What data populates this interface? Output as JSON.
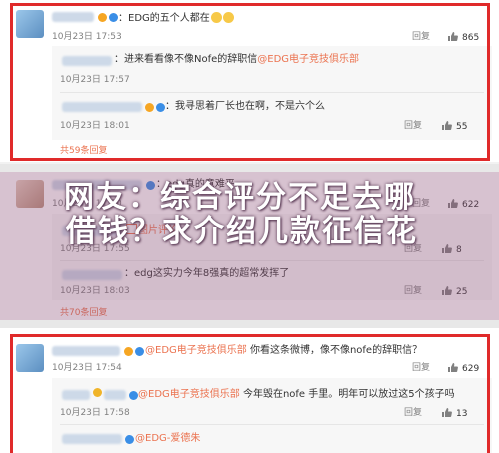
{
  "comments": [
    {
      "text_prefix": "：EDG的五个人都在",
      "time": "10月23日 17:53",
      "reply": "回复",
      "likes": "865",
      "replies": [
        {
          "text_prefix": "：进来看看像不像Nofe的辞职信",
          "mention": "@EDG电子竞技俱乐部",
          "time": "10月23日 17:57"
        },
        {
          "text_prefix": "：我寻思着厂长也在啊，不是六个么",
          "time": "10月23日 18:01",
          "reply": "回复",
          "likes": "55"
        }
      ],
      "more": "共59条回复"
    },
    {
      "text_prefix": "：edg真的意难平",
      "time": "10月23日 17:50",
      "reply": "回复",
      "likes": "622",
      "replies": [
        {
          "img_label": "图片评论",
          "time": "10月23日 17:55",
          "reply": "回复",
          "likes": "8"
        },
        {
          "text_prefix": "：edg这实力今年8强真的超常发挥了",
          "time": "10月23日 18:03",
          "reply": "回复",
          "likes": "25"
        }
      ],
      "more": "共70条回复"
    },
    {
      "mention": "@EDG电子竞技俱乐部",
      "text_suffix": " 你看这条微博，像不像nofe的辞职信？",
      "time": "10月23日 17:54",
      "reply": "回复",
      "likes": "629",
      "replies": [
        {
          "mention": "@EDG电子竞技俱乐部",
          "text_suffix": " 今年毁在nofe 手里。明年可以放过这5个孩子吗",
          "time": "10月23日 17:58",
          "reply": "回复",
          "likes": "13"
        },
        {
          "mention": "@EDG-爱德朱"
        }
      ]
    }
  ],
  "overlay": {
    "line1": "网友：综合评分不足去哪",
    "line2": "借钱？求介绍几款征信花"
  },
  "colors": {
    "accent": "#eb7350",
    "highlight_box": "#e02a2a"
  }
}
